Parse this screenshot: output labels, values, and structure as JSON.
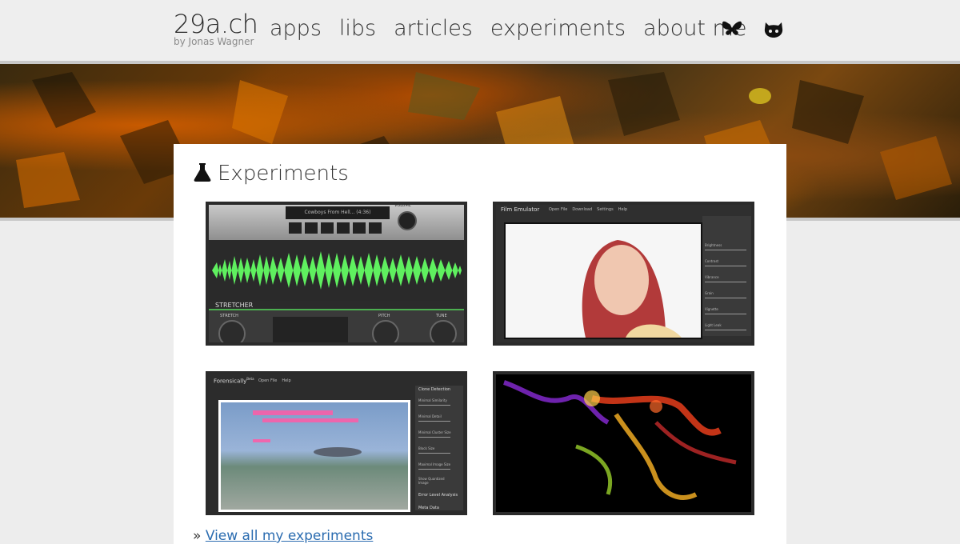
{
  "header": {
    "brand_title": "29a.ch",
    "brand_sub": "by Jonas Wagner",
    "nav": [
      "apps",
      "libs",
      "articles",
      "experiments",
      "about me"
    ],
    "icons": [
      "bluesky-icon",
      "github-icon"
    ]
  },
  "main": {
    "section_title": "Experiments",
    "section_icon": "flask-icon",
    "thumbnails": [
      {
        "name": "stretcher",
        "track": "Cowboys From Hell... (4:36)",
        "volume_label": "VOLUME",
        "app_label": "STRETCHER",
        "knobs": [
          "STRETCH",
          "PITCH",
          "TUNE"
        ]
      },
      {
        "name": "film-emulator",
        "app_title": "Film Emulator",
        "menu": [
          "Open File",
          "Download",
          "Settings",
          "Help"
        ],
        "side_labels": [
          "Brightness",
          "Contrast",
          "Vibrance",
          "Grain",
          "Vignette",
          "Light Leak"
        ]
      },
      {
        "name": "forensically",
        "app_title": "Forensically",
        "app_sup": "Beta",
        "menu": [
          "Open File",
          "Help"
        ],
        "side_labels": [
          "Clone Detection",
          "Minimal Similarity",
          "Minimal Detail",
          "Minimal Cluster Size",
          "Block Size",
          "Maximal Image Size",
          "Show Quantized Image",
          "Error Level Analysis",
          "Meta Data"
        ]
      },
      {
        "name": "fractal-flame"
      }
    ],
    "more_prefix": "»",
    "more_link": "View all my experiments"
  }
}
